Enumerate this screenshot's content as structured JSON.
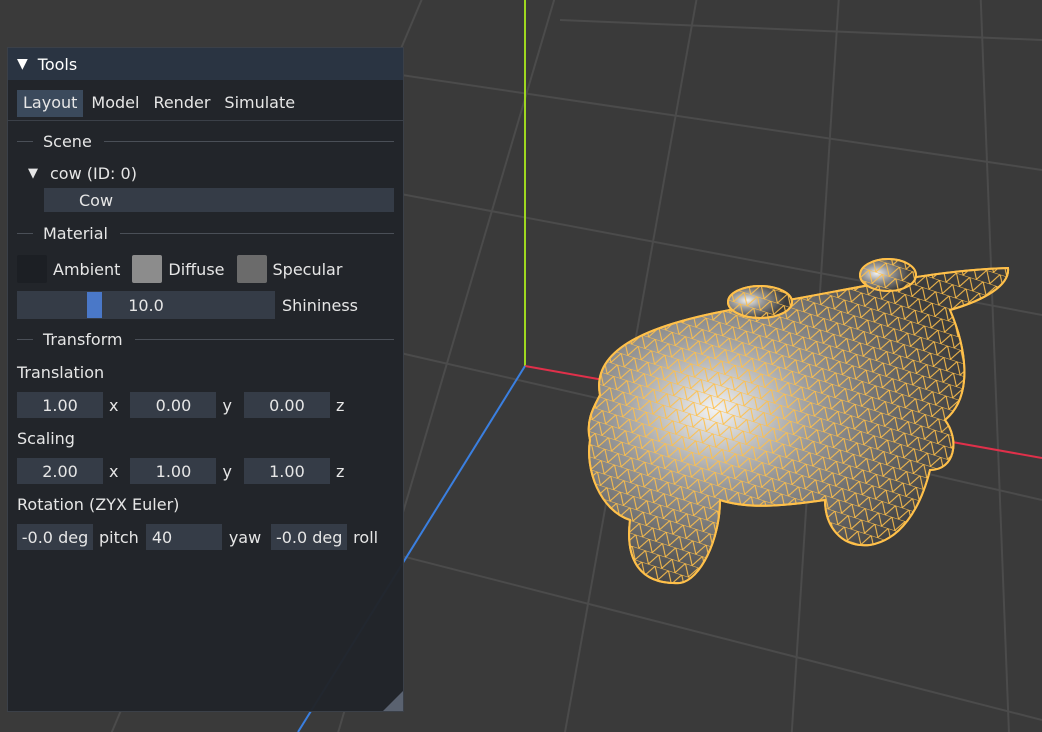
{
  "panel": {
    "title": "Tools",
    "tabs": [
      "Layout",
      "Model",
      "Render",
      "Simulate"
    ],
    "active_tab": "Layout"
  },
  "scene": {
    "heading": "Scene",
    "tree_item": "cow (ID: 0)",
    "name_value": "Cow"
  },
  "material": {
    "heading": "Material",
    "ambient_label": "Ambient",
    "diffuse_label": "Diffuse",
    "specular_label": "Specular",
    "ambient_color": "#1c1f24",
    "diffuse_color": "#8c8c8c",
    "specular_color": "#6b6b6b",
    "shininess_value": "10.0",
    "shininess_label": "Shininess",
    "shininess_fraction": 0.29
  },
  "transform": {
    "heading": "Transform",
    "translation_label": "Translation",
    "translation": [
      "1.00",
      "0.00",
      "0.00"
    ],
    "scaling_label": "Scaling",
    "scaling": [
      "2.00",
      "1.00",
      "1.00"
    ],
    "axis_x": "x",
    "axis_y": "y",
    "axis_z": "z",
    "rotation_label": "Rotation (ZYX Euler)",
    "pitch_value": "-0.0 deg",
    "pitch_label": "pitch",
    "yaw_value": "40",
    "yaw_label": "yaw",
    "roll_value": "-0.0 deg",
    "roll_label": "roll"
  },
  "colors": {
    "background": "#3a3a3a",
    "grid": "#4d4d4d",
    "axis_x": "#e0304a",
    "axis_y": "#9fd820",
    "axis_z": "#3a7fe0",
    "wireframe": "#ffc04a",
    "accent": "#4a78c8"
  }
}
